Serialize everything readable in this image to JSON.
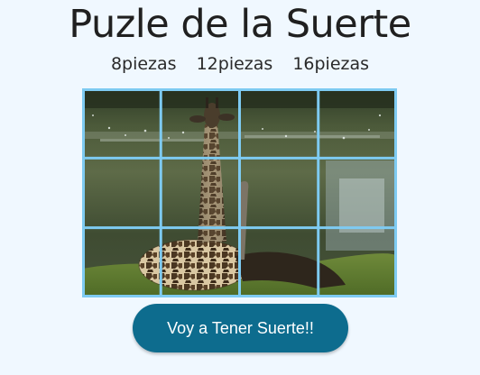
{
  "title": "Puzle de la Suerte",
  "piece_options": [
    {
      "label": "8piezas"
    },
    {
      "label": "12piezas"
    },
    {
      "label": "16piezas"
    }
  ],
  "puzzle": {
    "columns": 4,
    "rows": 3,
    "grid_color": "#7ecbf2",
    "image": "giraffe-lying-on-grass-by-pond"
  },
  "lucky_button": {
    "label": "Voy a Tener Suerte!!",
    "color": "#0d6c8e"
  }
}
